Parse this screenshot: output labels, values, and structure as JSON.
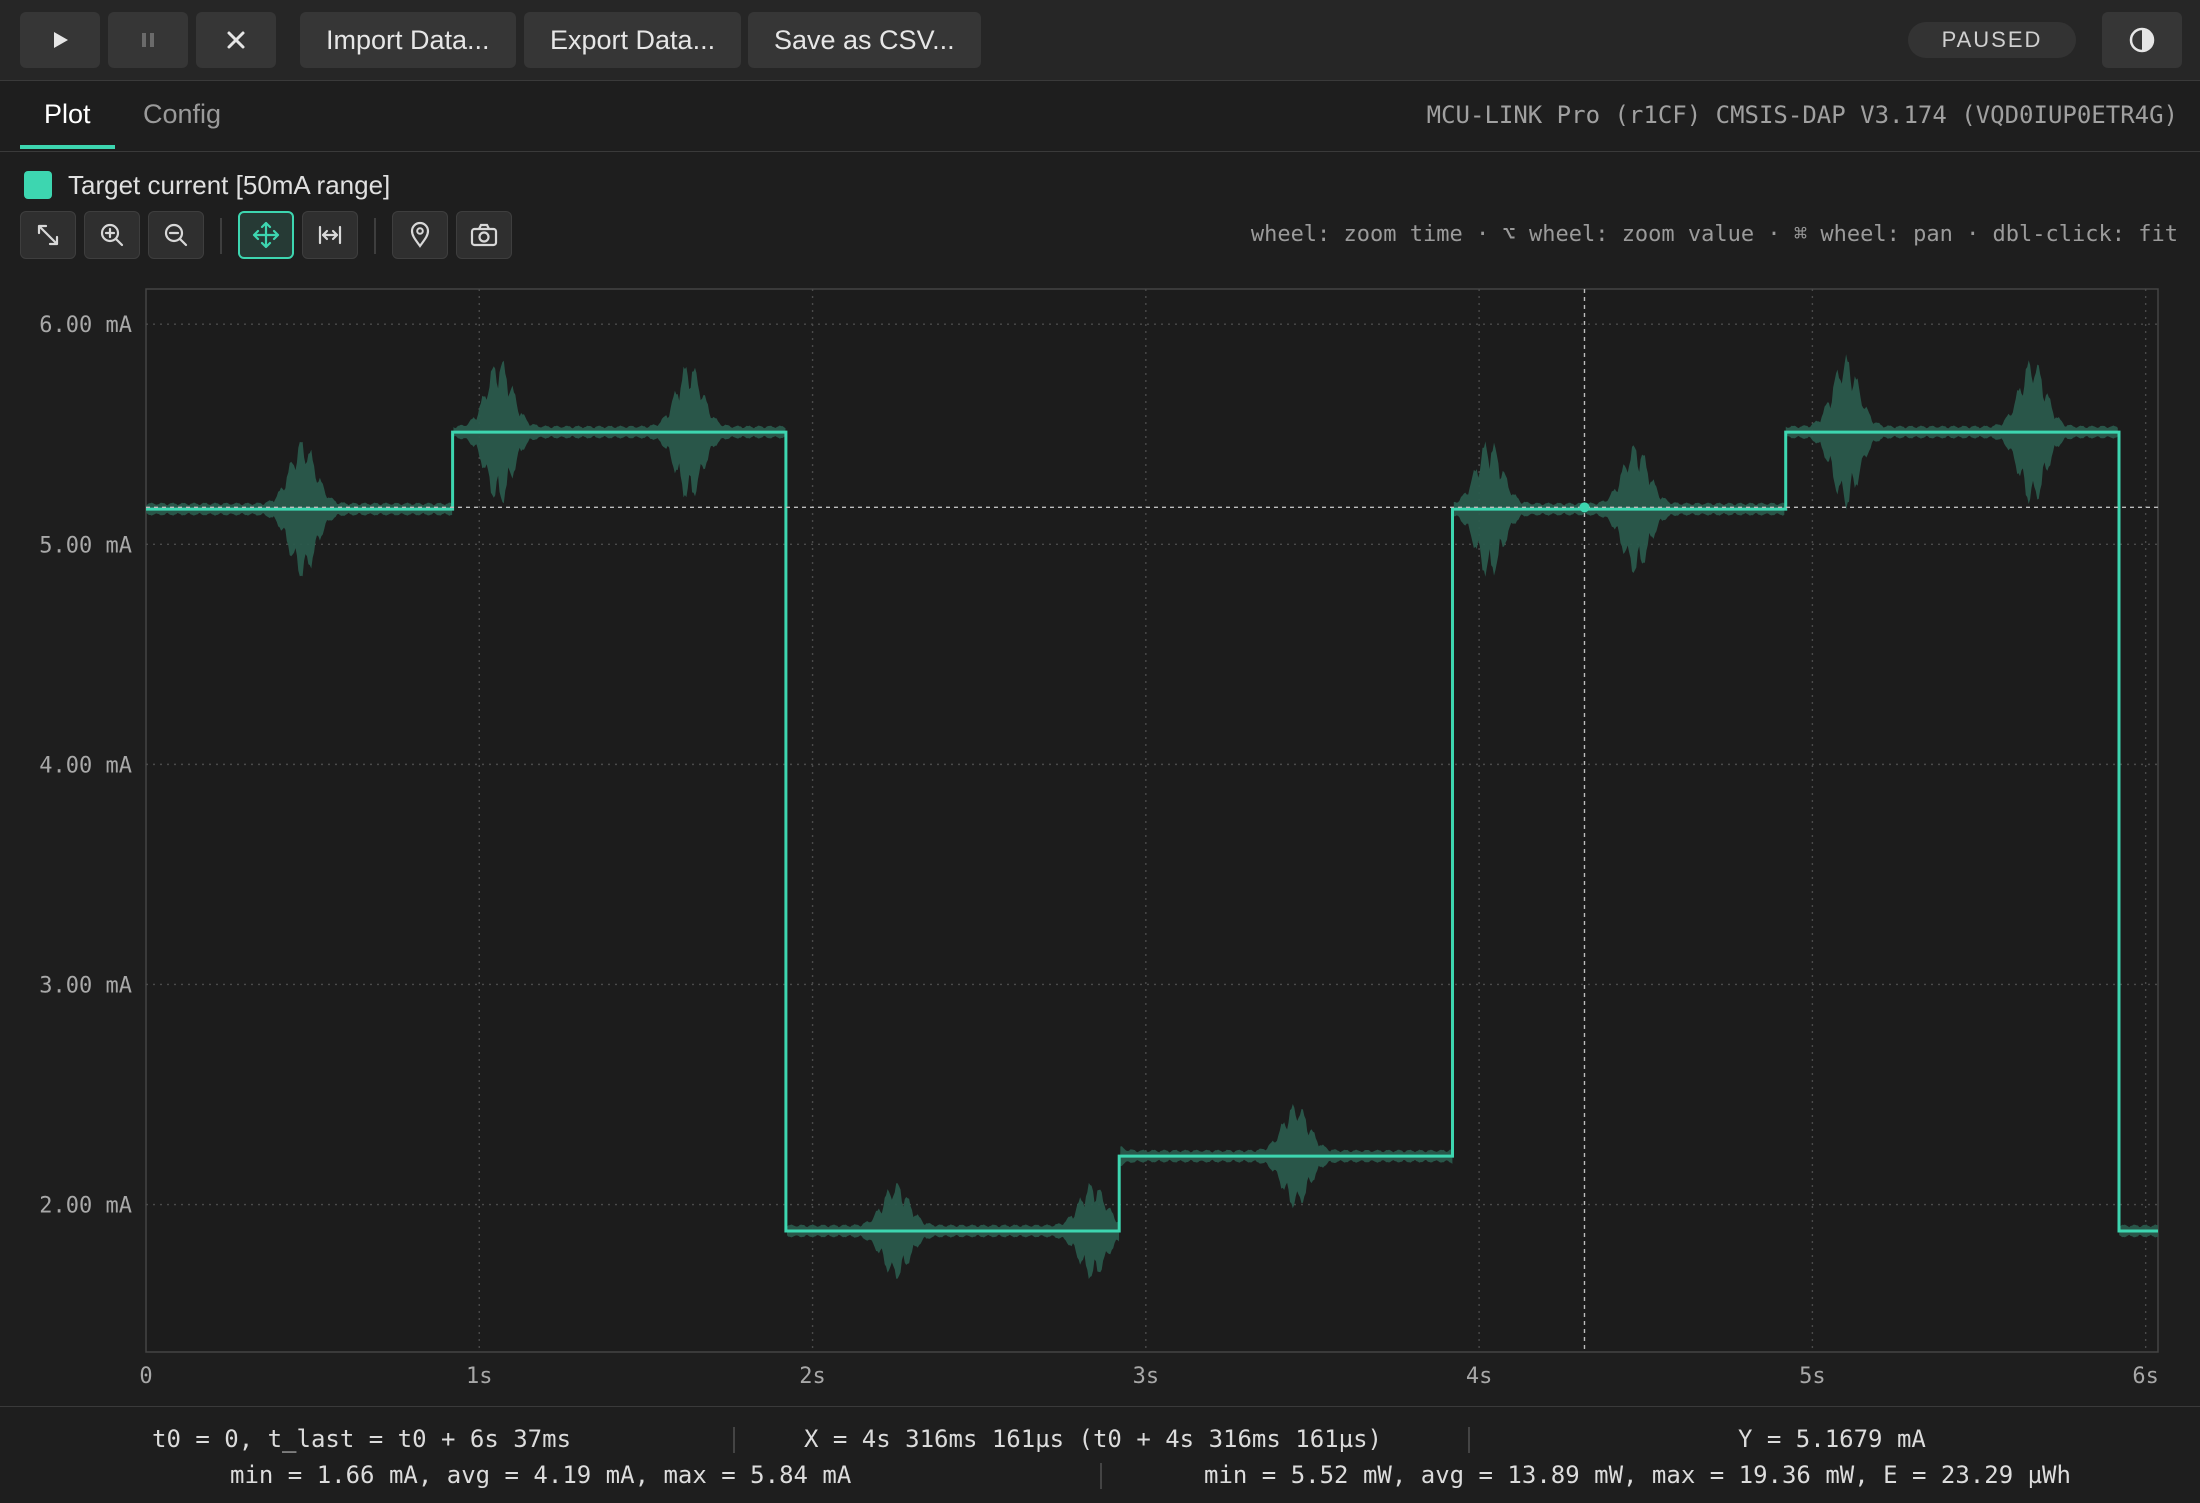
{
  "toolbar": {
    "play_icon": "play-icon",
    "pause_icon": "pause-icon",
    "stop_icon": "close-icon",
    "import_label": "Import Data...",
    "export_label": "Export Data...",
    "save_csv_label": "Save as CSV...",
    "status": "PAUSED",
    "theme_icon": "contrast-icon"
  },
  "tabs": [
    {
      "label": "Plot",
      "active": true
    },
    {
      "label": "Config",
      "active": false
    }
  ],
  "device_info": "MCU-LINK Pro (r1CF) CMSIS-DAP V3.174 (VQD0IUP0ETR4G)",
  "legend": {
    "label": "Target current [50mA range]",
    "color": "#3dd6b0"
  },
  "plot_toolbar": {
    "icons": [
      "fit-icon",
      "zoom-in-icon",
      "zoom-out-icon",
      "pan-icon",
      "fit-width-icon",
      "marker-icon",
      "camera-icon"
    ],
    "active": "pan-icon",
    "hint": "wheel: zoom time · ⌥ wheel: zoom value · ⌘ wheel: pan · dbl-click: fit"
  },
  "chart_data": {
    "type": "line",
    "x_unit": "s",
    "y_unit": "mA",
    "xlim": [
      0,
      6.037
    ],
    "ylim": [
      1.33,
      6.16
    ],
    "x_ticks": [
      {
        "value": 0,
        "label": "0"
      },
      {
        "value": 1,
        "label": "1s"
      },
      {
        "value": 2,
        "label": "2s"
      },
      {
        "value": 3,
        "label": "3s"
      },
      {
        "value": 4,
        "label": "4s"
      },
      {
        "value": 5,
        "label": "5s"
      },
      {
        "value": 6,
        "label": "6s"
      }
    ],
    "y_ticks": [
      {
        "value": 6,
        "label": "6.00 mA"
      },
      {
        "value": 5,
        "label": "5.00 mA"
      },
      {
        "value": 4,
        "label": "4.00 mA"
      },
      {
        "value": 3,
        "label": "3.00 mA"
      },
      {
        "value": 2,
        "label": "2.00 mA"
      }
    ],
    "grid": true,
    "series": [
      {
        "color": "#3dd6b0",
        "segments": [
          {
            "t0": 0.0,
            "t1": 0.92,
            "level": 5.16
          },
          {
            "t0": 0.92,
            "t1": 1.92,
            "level": 5.51
          },
          {
            "t0": 1.92,
            "t1": 2.92,
            "level": 1.88
          },
          {
            "t0": 2.92,
            "t1": 3.92,
            "level": 2.22
          },
          {
            "t0": 3.92,
            "t1": 4.92,
            "level": 5.16
          },
          {
            "t0": 4.92,
            "t1": 5.92,
            "level": 5.51
          },
          {
            "t0": 5.92,
            "t1": 6.037,
            "level": 1.88
          }
        ],
        "envelope_bursts": [
          {
            "t": 0.47,
            "amp": 0.3
          },
          {
            "t": 1.06,
            "amp": 0.32
          },
          {
            "t": 1.63,
            "amp": 0.3
          },
          {
            "t": 2.25,
            "amp": 0.2
          },
          {
            "t": 2.84,
            "amp": 0.2
          },
          {
            "t": 3.45,
            "amp": 0.22
          },
          {
            "t": 4.03,
            "amp": 0.3
          },
          {
            "t": 4.47,
            "amp": 0.28
          },
          {
            "t": 5.1,
            "amp": 0.33
          },
          {
            "t": 5.66,
            "amp": 0.32
          }
        ]
      }
    ],
    "cursor": {
      "x": 4.316161,
      "y": 5.1679
    }
  },
  "footer": {
    "time_range": "t0 = 0, t_last = t0 + 6s 37ms",
    "cursor_x": "X = 4s 316ms 161µs (t0 + 4s 316ms 161µs)",
    "cursor_y": "Y = 5.1679 mA",
    "current_stats": "min = 1.66 mA, avg = 4.19 mA, max = 5.84 mA",
    "power_stats": "min = 5.52 mW, avg = 13.89 mW, max = 19.36 mW, E = 23.29 µWh"
  }
}
